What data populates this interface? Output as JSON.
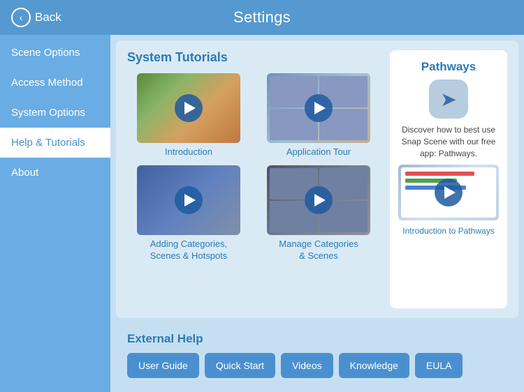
{
  "header": {
    "back_label": "Back",
    "title": "Settings"
  },
  "sidebar": {
    "items": [
      {
        "id": "scene-options",
        "label": "Scene Options",
        "active": false
      },
      {
        "id": "access-method",
        "label": "Access Method",
        "active": false
      },
      {
        "id": "system-options",
        "label": "System Options",
        "active": false
      },
      {
        "id": "help-tutorials",
        "label": "Help & Tutorials",
        "active": true
      },
      {
        "id": "about",
        "label": "About",
        "active": false
      }
    ]
  },
  "tutorials": {
    "title": "System Tutorials",
    "videos": [
      {
        "id": "intro",
        "label": "Introduction"
      },
      {
        "id": "app-tour",
        "label": "Application Tour"
      },
      {
        "id": "adding-cat",
        "label": "Adding Categories,\nScenes & Hotspots"
      },
      {
        "id": "manage-cat",
        "label": "Manage Categories\n& Scenes"
      }
    ]
  },
  "pathways": {
    "title": "Pathways",
    "description": "Discover how to best use Snap Scene with our free app: Pathways.",
    "video_label": "Introduction to Pathways"
  },
  "external_help": {
    "title": "External Help",
    "buttons": [
      {
        "id": "user-guide",
        "label": "User Guide"
      },
      {
        "id": "quick-start",
        "label": "Quick Start"
      },
      {
        "id": "videos",
        "label": "Videos"
      },
      {
        "id": "knowledge",
        "label": "Knowledge"
      },
      {
        "id": "eula",
        "label": "EULA"
      }
    ]
  }
}
